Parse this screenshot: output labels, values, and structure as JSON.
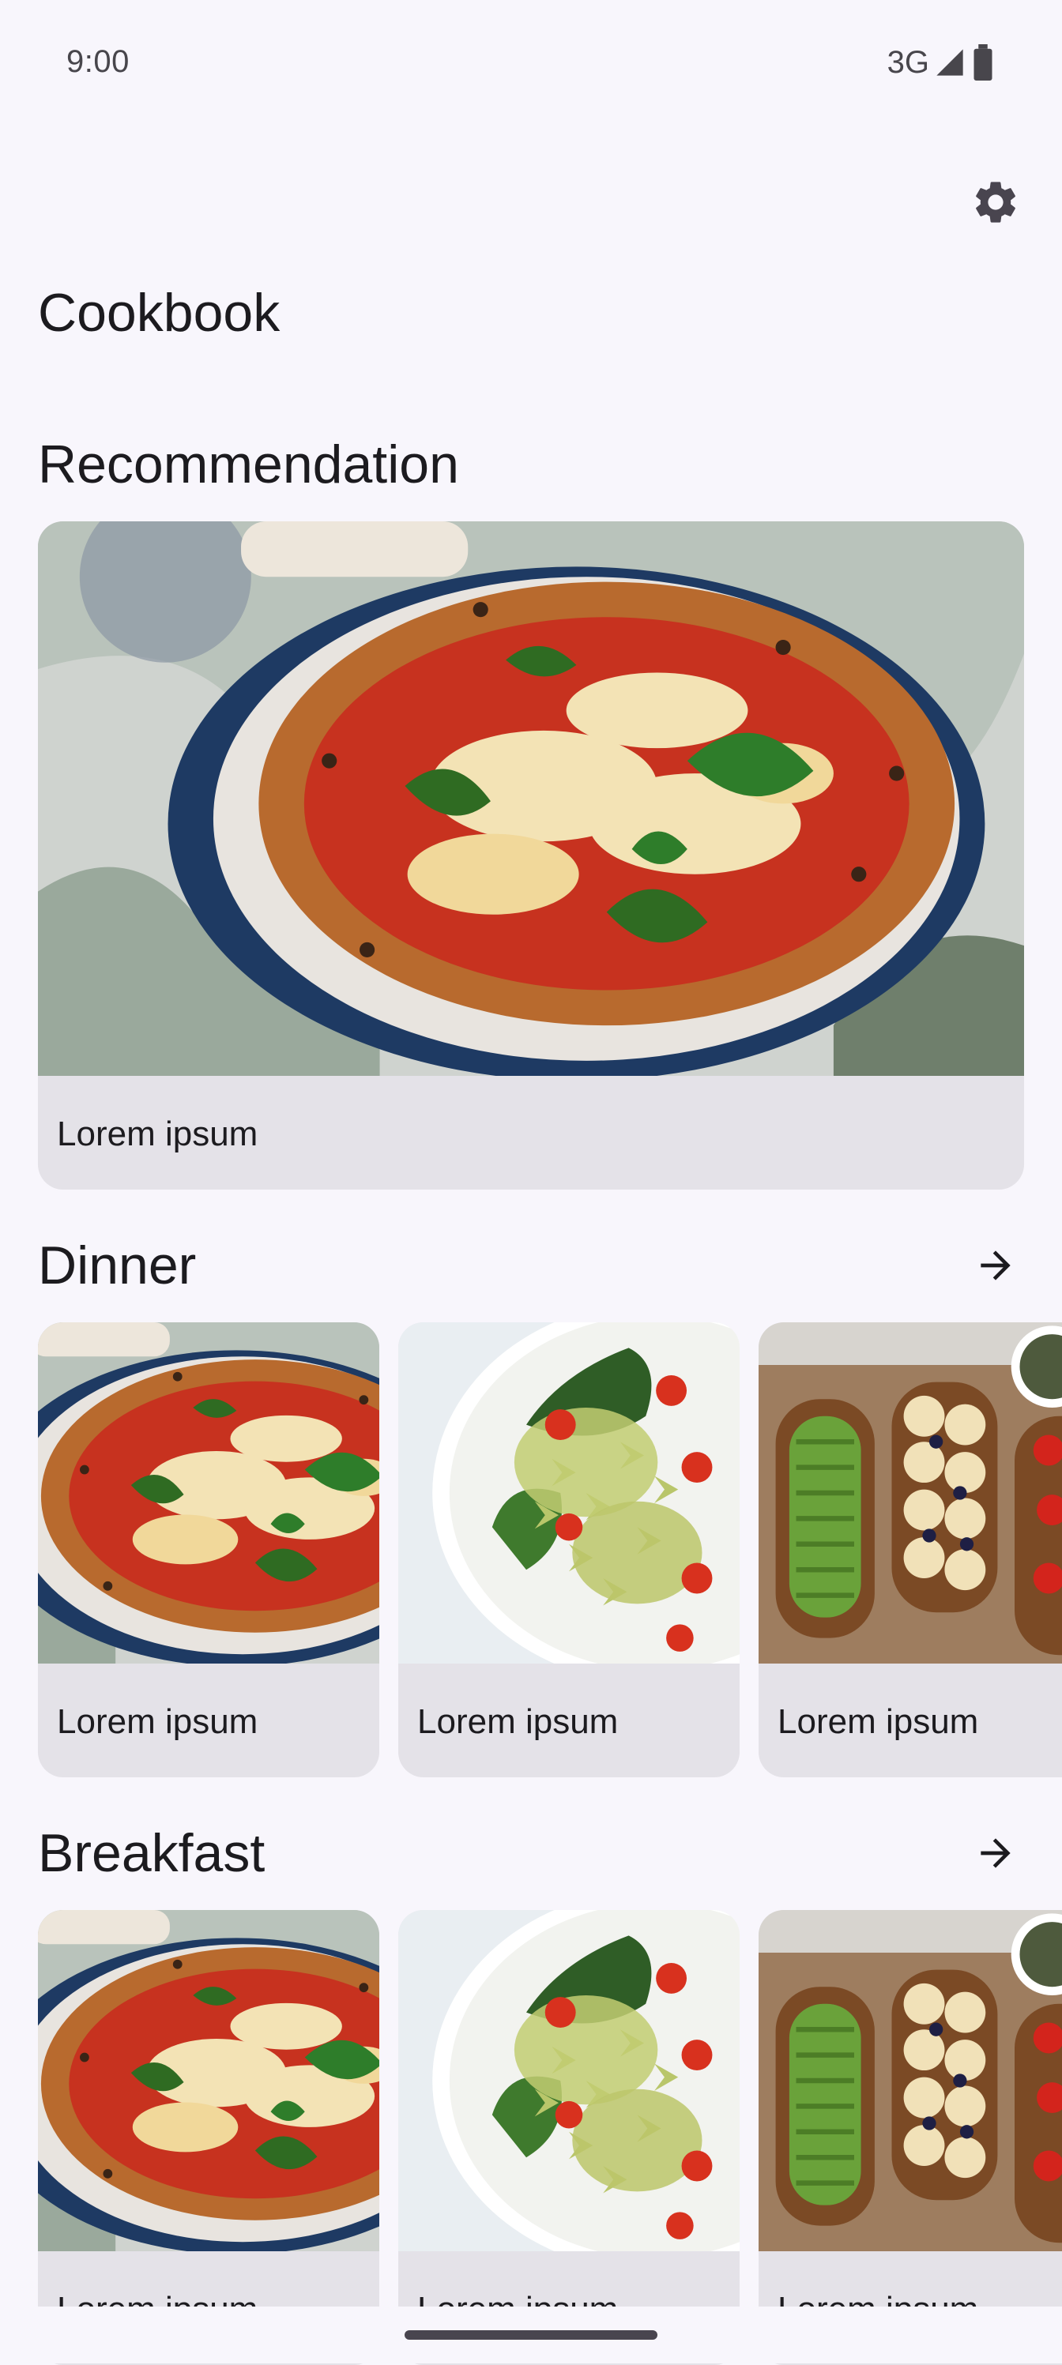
{
  "status_bar": {
    "time": "9:00",
    "network": "3G"
  },
  "app": {
    "title": "Cookbook"
  },
  "icons": {
    "settings": "gear-icon",
    "arrow": "arrow-right-icon"
  },
  "recommendation": {
    "title": "Recommendation",
    "card": {
      "caption": "Lorem ipsum",
      "image": "pizza"
    }
  },
  "dinner": {
    "title": "Dinner",
    "cards": [
      {
        "caption": "Lorem ipsum",
        "image": "pizza"
      },
      {
        "caption": "Lorem ipsum",
        "image": "pasta-salad"
      },
      {
        "caption": "Lorem ipsum",
        "image": "toasts"
      }
    ]
  },
  "breakfast": {
    "title": "Breakfast",
    "cards": [
      {
        "caption": "Lorem ipsum",
        "image": "pizza"
      },
      {
        "caption": "Lorem ipsum",
        "image": "pasta-salad"
      },
      {
        "caption": "Lorem ipsum",
        "image": "toasts"
      }
    ]
  },
  "colors": {
    "background": "#f8f6fc",
    "card": "#e4e2e8",
    "text": "#1c1b1f"
  }
}
